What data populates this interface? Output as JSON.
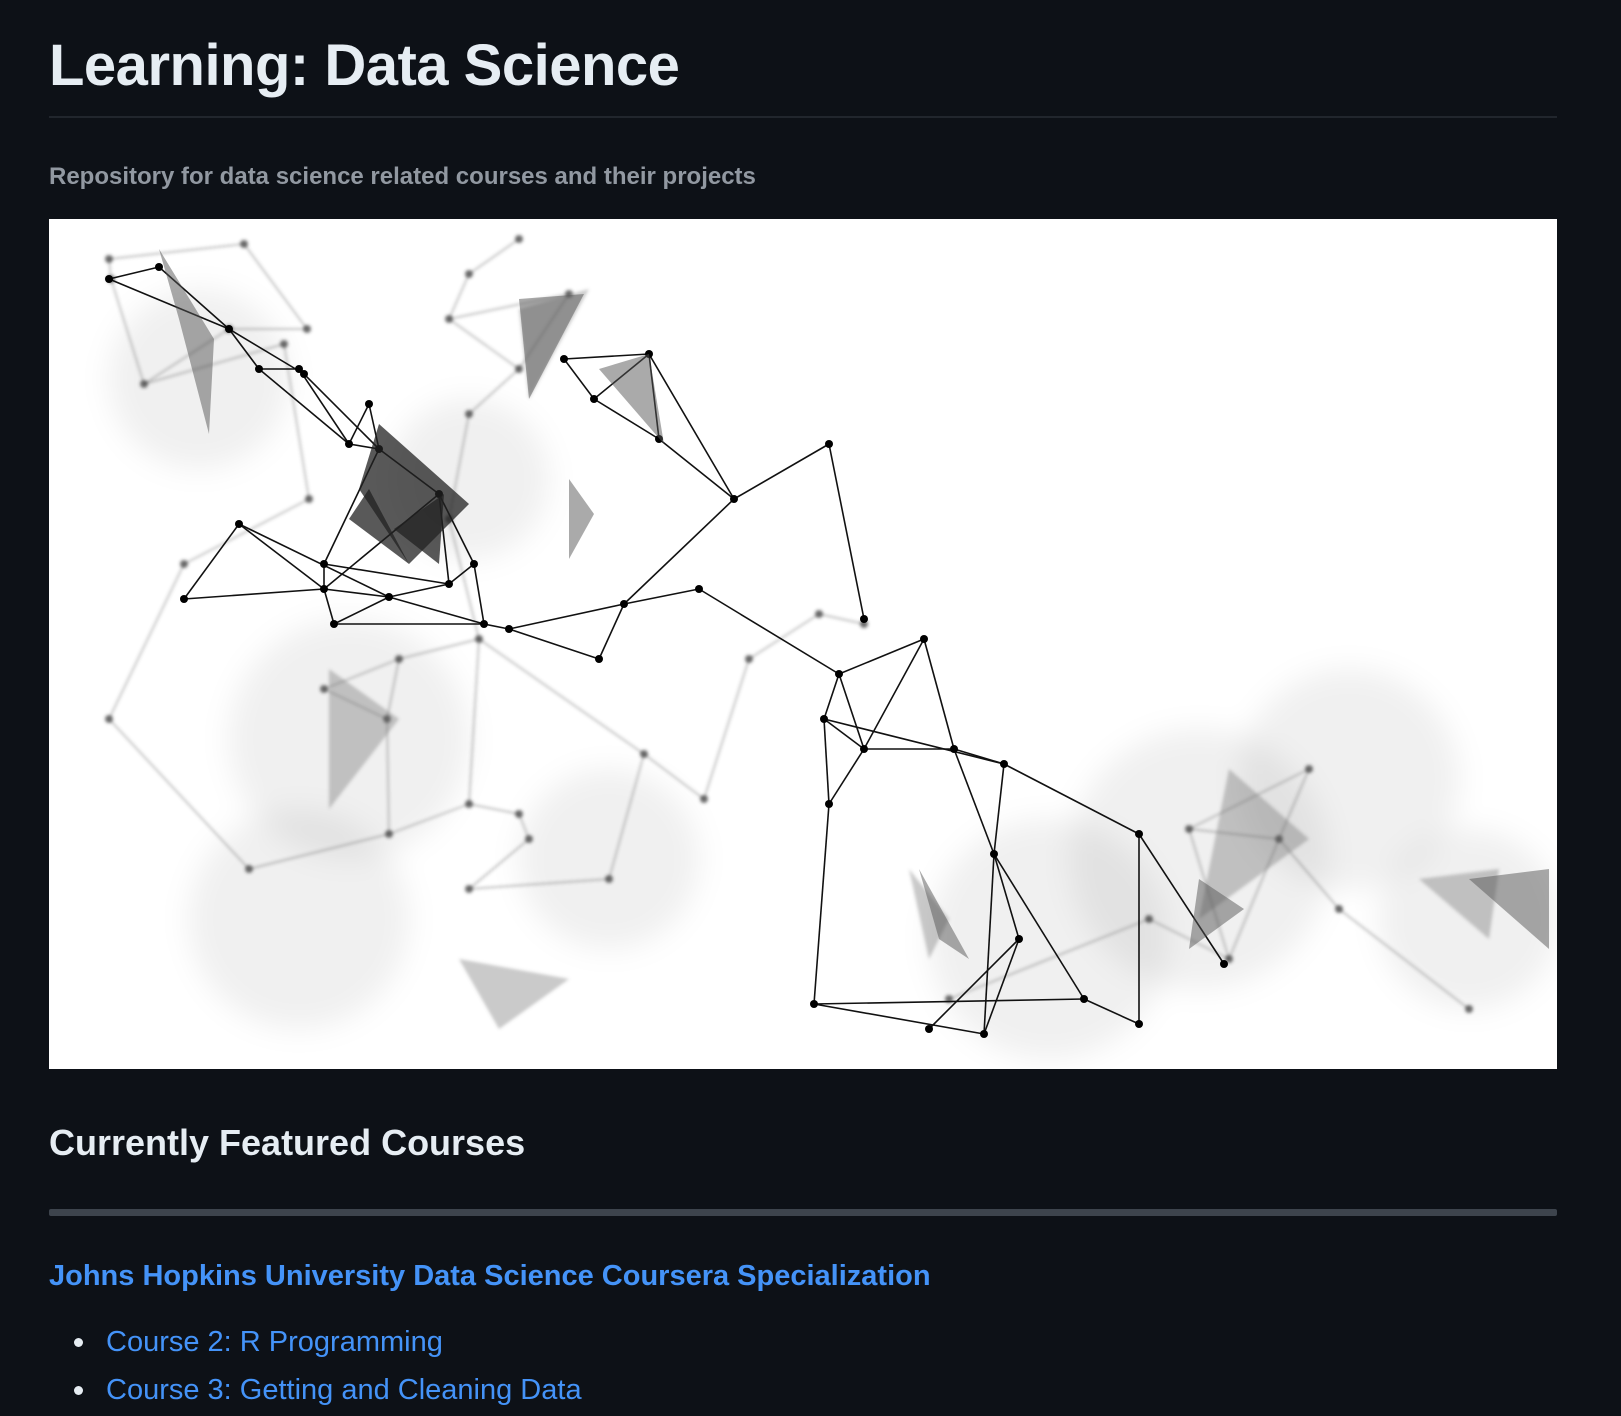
{
  "readme": {
    "title": "Learning: Data Science",
    "description": "Repository for data science related courses and their projects",
    "section_heading": "Currently Featured Courses",
    "specialization_link": "Johns Hopkins University Data Science Coursera Specialization",
    "courses": [
      {
        "label": "Course 2: R Programming"
      },
      {
        "label": "Course 3: Getting and Cleaning Data"
      }
    ]
  },
  "colors": {
    "background": "#0d1117",
    "text": "#e6edf3",
    "muted_text": "#9198a1",
    "link": "#4493f8",
    "hero_background": "#ffffff"
  },
  "hero_image": {
    "subject": "network-graph-illustration"
  }
}
